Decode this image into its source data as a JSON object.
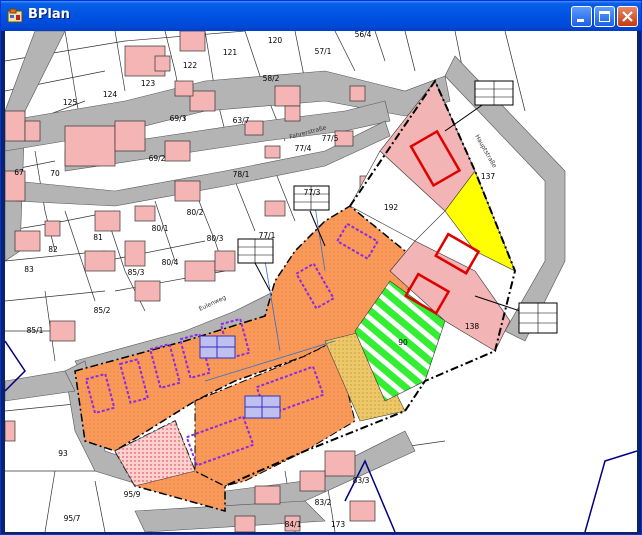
{
  "window": {
    "title": "BPlan"
  },
  "icons": {
    "app": "bplan-app-icon",
    "minimize": "minimize-icon",
    "maximize": "maximize-icon",
    "close": "close-icon"
  },
  "colors": {
    "titlebar": "#0054e3",
    "parcel_fill": "#ffffff",
    "building_fill": "#f5b5b5",
    "road_fill": "#b4b4b4",
    "development_area": "#f99a5b",
    "green_area": "#33ee33",
    "yellow_area": "#ffff00",
    "pink_area": "#f2b4b4"
  },
  "parcels": [
    "120",
    "121",
    "122",
    "123",
    "124",
    "125",
    "57/1",
    "56/4",
    "58/2",
    "69/3",
    "63/7",
    "69/2",
    "77/5",
    "77/4",
    "67",
    "70",
    "78/1",
    "80/2",
    "81",
    "82",
    "80/1",
    "80/3",
    "77/1",
    "83",
    "85/3",
    "80/4",
    "85/2",
    "85/1",
    "93",
    "95/9",
    "95/7",
    "83/3",
    "83/2",
    "84/1",
    "173",
    "192",
    "137",
    "138",
    "90",
    "77/3"
  ],
  "roads": [
    "Fahrerstraße",
    "Eulenweg",
    "Hauptstraße"
  ]
}
